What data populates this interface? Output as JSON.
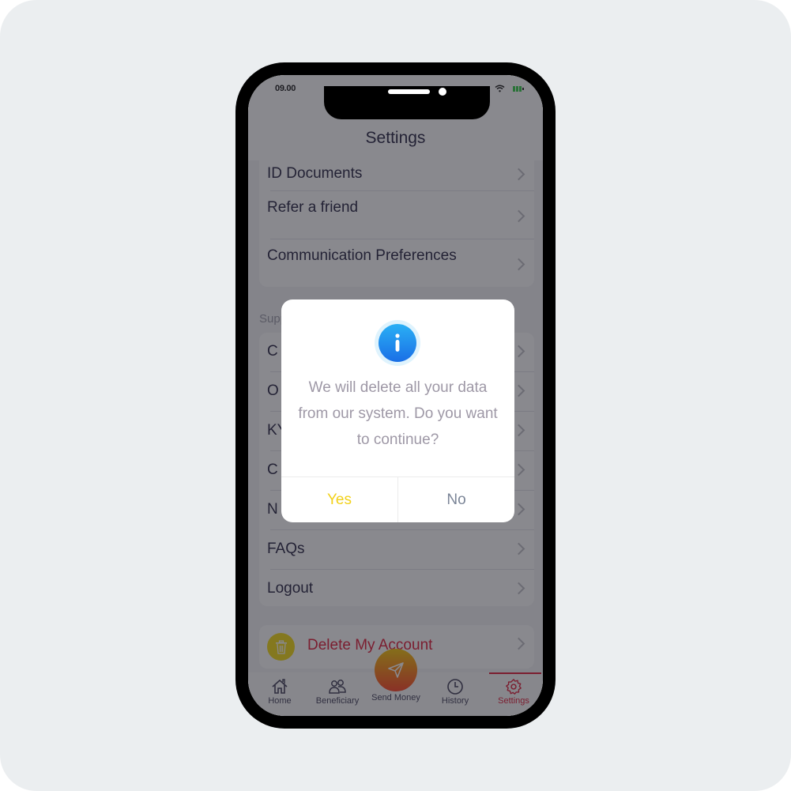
{
  "status_bar": {
    "time": "09.00",
    "wifi_icon": "wifi-icon",
    "battery_icon": "battery-icon"
  },
  "header": {
    "title": "Settings"
  },
  "settings": {
    "account_items": [
      {
        "label": "ID Documents"
      },
      {
        "label": "Refer a friend"
      },
      {
        "label": "Communication Preferences"
      }
    ],
    "support_section_label": "Support",
    "support_items": [
      {
        "label": "C"
      },
      {
        "label": "O"
      },
      {
        "label": "KY"
      },
      {
        "label": "C"
      },
      {
        "label": "N"
      },
      {
        "label": "FAQs"
      },
      {
        "label": "Logout"
      }
    ],
    "delete_account": {
      "label": "Delete My Account",
      "icon": "trash-icon",
      "color": "#e11230"
    }
  },
  "tabbar": {
    "tabs": [
      {
        "label": "Home",
        "icon": "home-icon"
      },
      {
        "label": "Beneficiary",
        "icon": "users-icon"
      },
      {
        "label": "Send Money",
        "icon": "send-icon"
      },
      {
        "label": "History",
        "icon": "clock-icon"
      },
      {
        "label": "Settings",
        "icon": "gear-icon",
        "active": true
      }
    ]
  },
  "dialog": {
    "icon": "info-icon",
    "message": "We will delete all your data from our system. Do you want to continue?",
    "yes_label": "Yes",
    "no_label": "No",
    "yes_color": "#f2d11a",
    "no_color": "#7b8597"
  },
  "colors": {
    "accent": "#e11230",
    "brand_yellow": "#f4d90a",
    "info_blue": "#1e88f0"
  }
}
